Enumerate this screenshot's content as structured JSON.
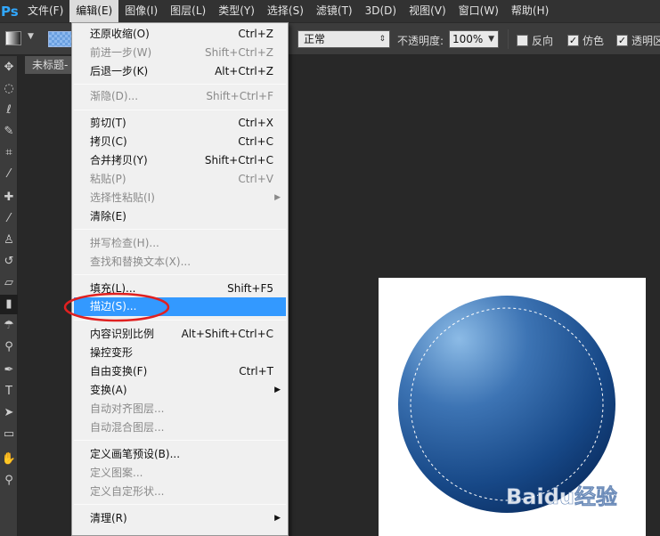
{
  "app": {
    "logo": "Ps"
  },
  "menubar": {
    "items": [
      "文件(F)",
      "编辑(E)",
      "图像(I)",
      "图层(L)",
      "类型(Y)",
      "选择(S)",
      "滤镜(T)",
      "3D(D)",
      "视图(V)",
      "窗口(W)",
      "帮助(H)"
    ],
    "active_index": 1
  },
  "options": {
    "mode_value": "正常",
    "opacity_label": "不透明度:",
    "opacity_value": "100%",
    "reverse_label": "反向",
    "dither_label": "仿色",
    "transparency_label": "透明区",
    "reverse_checked": false,
    "dither_checked": true,
    "transparency_checked": true
  },
  "document": {
    "tab_title": "未标题-"
  },
  "edit_menu": {
    "items": [
      {
        "label": "还原收缩(O)",
        "shortcut": "Ctrl+Z",
        "disabled": false
      },
      {
        "label": "前进一步(W)",
        "shortcut": "Shift+Ctrl+Z",
        "disabled": true
      },
      {
        "label": "后退一步(K)",
        "shortcut": "Alt+Ctrl+Z",
        "disabled": false
      },
      {
        "label": "渐隐(D)...",
        "shortcut": "Shift+Ctrl+F",
        "disabled": true
      },
      {
        "label": "剪切(T)",
        "shortcut": "Ctrl+X",
        "disabled": false
      },
      {
        "label": "拷贝(C)",
        "shortcut": "Ctrl+C",
        "disabled": false
      },
      {
        "label": "合并拷贝(Y)",
        "shortcut": "Shift+Ctrl+C",
        "disabled": false
      },
      {
        "label": "粘贴(P)",
        "shortcut": "Ctrl+V",
        "disabled": true
      },
      {
        "label": "选择性粘贴(I)",
        "shortcut": "",
        "disabled": true,
        "submenu": true
      },
      {
        "label": "清除(E)",
        "shortcut": "",
        "disabled": false
      },
      {
        "label": "拼写检查(H)...",
        "shortcut": "",
        "disabled": true
      },
      {
        "label": "查找和替换文本(X)...",
        "shortcut": "",
        "disabled": true
      },
      {
        "label": "填充(L)...",
        "shortcut": "Shift+F5",
        "disabled": false
      },
      {
        "label": "描边(S)...",
        "shortcut": "",
        "disabled": false,
        "highlighted": true
      },
      {
        "label": "内容识别比例",
        "shortcut": "Alt+Shift+Ctrl+C",
        "disabled": false
      },
      {
        "label": "操控变形",
        "shortcut": "",
        "disabled": false
      },
      {
        "label": "自由变换(F)",
        "shortcut": "Ctrl+T",
        "disabled": false
      },
      {
        "label": "变换(A)",
        "shortcut": "",
        "disabled": false,
        "submenu": true
      },
      {
        "label": "自动对齐图层...",
        "shortcut": "",
        "disabled": true
      },
      {
        "label": "自动混合图层...",
        "shortcut": "",
        "disabled": true
      },
      {
        "label": "定义画笔预设(B)...",
        "shortcut": "",
        "disabled": false
      },
      {
        "label": "定义图案...",
        "shortcut": "",
        "disabled": true
      },
      {
        "label": "定义自定形状...",
        "shortcut": "",
        "disabled": true
      },
      {
        "label": "清理(R)",
        "shortcut": "",
        "disabled": false,
        "submenu": true
      }
    ]
  },
  "watermark": {
    "text": "Baidu经验"
  },
  "colors": {
    "menu_highlight": "#3399ff",
    "annotation": "#e02020",
    "circle_dark": "#0d3a78",
    "circle_light": "#7fb0e0"
  }
}
